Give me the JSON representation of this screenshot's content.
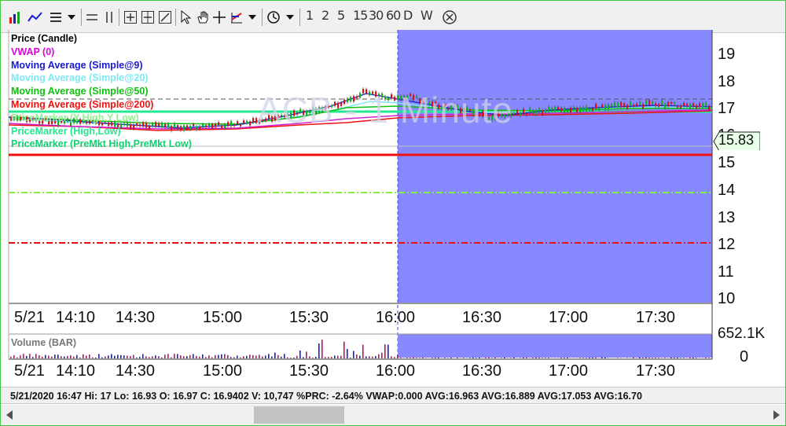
{
  "toolbar": {
    "timeframes": [
      "1",
      "2",
      "5",
      "15",
      "30",
      "60",
      "D",
      "W"
    ]
  },
  "chart": {
    "symbol_watermark": "ACB - 1 Minute",
    "legend": [
      {
        "text": "Price (Candle)",
        "color": "#000000"
      },
      {
        "text": "VWAP (0)",
        "color": "#e000e0"
      },
      {
        "text": "Moving Average (Simple@9)",
        "color": "#1a1ad0"
      },
      {
        "text": "Moving Average (Simple@20)",
        "color": "#7fe8f0"
      },
      {
        "text": "Moving Average (Simple@50)",
        "color": "#10c010"
      },
      {
        "text": "Moving Average (Simple@200)",
        "color": "#ee1010"
      },
      {
        "text": "PriceMarker (Y High,Y Low)",
        "color": "#90f090"
      },
      {
        "text": "PriceMarker (High,Low)",
        "color": "#22e890"
      },
      {
        "text": "PriceMarker (PreMkt High,PreMkt Low)",
        "color": "#10d070"
      }
    ],
    "y_ticks": [
      "19",
      "18",
      "17",
      "16",
      "15",
      "14",
      "13",
      "12",
      "11",
      "10"
    ],
    "x_ticks": [
      "5/21",
      "14:10",
      "14:30",
      "15:00",
      "15:30",
      "16:00",
      "16:30",
      "17:00",
      "17:30"
    ],
    "current_price": "15.83",
    "volume_label": "Volume (BAR)",
    "volume_ticks": [
      "652.1K",
      "0"
    ],
    "colors": {
      "afterhours_shade": "#8888ff",
      "price_marker_red": "#ee1010",
      "price_marker_green": "#22e890"
    }
  },
  "status_bar": {
    "text": "5/21/2020 16:47  Hi: 17  Lo: 16.93  O: 16.97  C: 16.9402  V: 10,747 %PRC: -2.64% VWAP:0.000 AVG:16.963 AVG:16.889 AVG:17.053 AVG:16.70"
  }
}
